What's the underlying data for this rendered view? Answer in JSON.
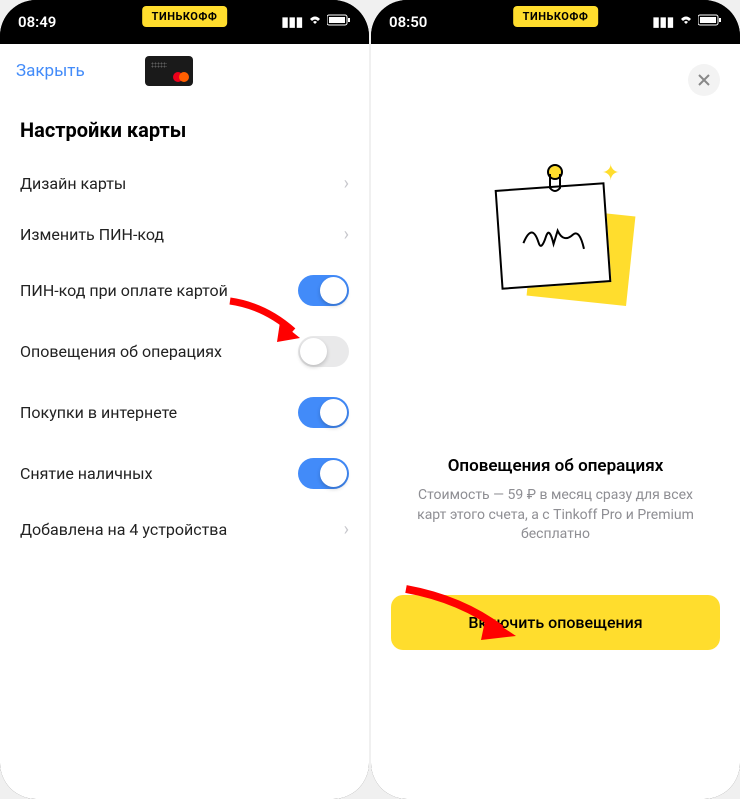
{
  "left": {
    "status_time": "08:49",
    "brand": "ТИНЬКОФФ",
    "close_label": "Закрыть",
    "section_title": "Настройки карты",
    "rows": {
      "design": "Дизайн карты",
      "change_pin": "Изменить ПИН-код",
      "pin_payment": "ПИН-код при оплате картой",
      "notifications": "Оповещения об операциях",
      "online": "Покупки в интернете",
      "cash": "Снятие наличных",
      "devices": "Добавлена на 4 устройства"
    },
    "toggles": {
      "pin_payment": true,
      "notifications": false,
      "online": true,
      "cash": true
    }
  },
  "right": {
    "status_time": "08:50",
    "brand": "ТИНЬКОФФ",
    "promo_title": "Оповещения об операциях",
    "promo_desc": "Стоимость — 59 ₽ в месяц сразу для всех карт этого счета, а с Tinkoff Pro и Premium бесплатно",
    "cta_label": "Включить оповещения"
  }
}
